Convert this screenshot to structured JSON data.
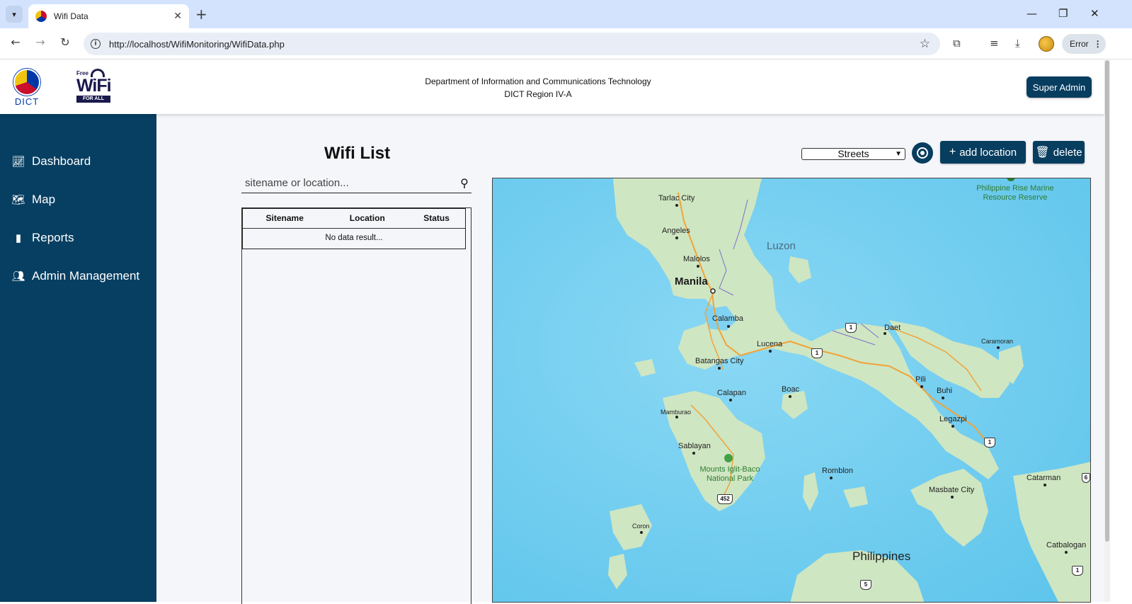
{
  "browser": {
    "tab_title": "Wifi Data",
    "url": "http://localhost/WifiMonitoring/WifiData.php",
    "error_label": "Error"
  },
  "header": {
    "dict_logo_text": "DICT",
    "wifi_logo_free": "Free",
    "wifi_logo_wifi": "WiFi",
    "wifi_logo_band": "FOR ALL",
    "department": "Department of Information and Communications Technology",
    "region": "DICT Region IV-A",
    "user_button": "Super Admin"
  },
  "sidebar": {
    "items": [
      {
        "label": "Dashboard",
        "icon": "chart-line-icon"
      },
      {
        "label": "Map",
        "icon": "map-icon"
      },
      {
        "label": "Reports",
        "icon": "clipboard-icon"
      },
      {
        "label": "Admin Management",
        "icon": "users-icon"
      }
    ]
  },
  "main": {
    "title": "Wifi List",
    "search": {
      "placeholder": "sitename or location...",
      "value": ""
    },
    "table": {
      "columns": [
        "Sitename",
        "Location",
        "Status"
      ],
      "empty_message": "No data result..."
    },
    "map_style_select": {
      "selected": "Streets"
    },
    "add_button": "add location",
    "delete_button": "delete"
  },
  "map": {
    "labels": {
      "tarlac": "Tarlac City",
      "angeles": "Angeles",
      "malolos": "Malolos",
      "manila": "Manila",
      "luzon": "Luzon",
      "calamba": "Calamba",
      "lucena": "Lucena",
      "batangas": "Batangas City",
      "calapan": "Calapan",
      "boac": "Boac",
      "mamburao": "Mamburao",
      "sablayan": "Sablayan",
      "park": "Mounts Iglit-Baco National Park",
      "romblon": "Romblon",
      "coron": "Coron",
      "daet": "Daet",
      "caramoran": "Caramoran",
      "pili": "Pili",
      "buhi": "Buhi",
      "legazpi": "Legazpi",
      "masbate": "Masbate City",
      "catarman": "Catarman",
      "catbalogan": "Catbalogan",
      "philippines": "Philippines",
      "rise": "Philippine Rise Marine Resource Reserve"
    },
    "shields": [
      "1",
      "1",
      "1",
      "452",
      "1",
      "5",
      "6"
    ],
    "colors": {
      "water": "#6ecff0",
      "land": "#cfe6c2",
      "road": "#f0a33a",
      "accent": "#073d5f"
    }
  }
}
